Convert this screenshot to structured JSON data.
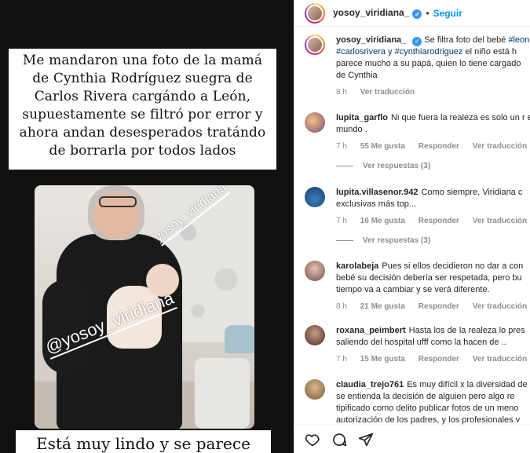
{
  "story": {
    "top_text": "Me mandaron una foto de la mamá\nde Cynthia Rodríguez suegra de\nCarlos Rivera cargándo a León,\nsupuestamente se filtró por error y\nahora andan desesperados tratándo\nde borrarla por todos lados",
    "bottom_text": "Está muy lindo y se parece",
    "watermark_small": "yosoy_viridiana",
    "watermark_large": "@yosoy_viridiana"
  },
  "header": {
    "username": "yosoy_viridiana_",
    "separator": "•",
    "follow_label": "Seguir"
  },
  "caption": {
    "username": "yosoy_viridiana_",
    "text_1": "Se filtra foto del bebé",
    "tag_1": "#leon",
    "tag_2": "#carlosrivera",
    "text_2": "y",
    "tag_3": "#cynthiarodriguez",
    "text_3": "el niño está h",
    "line_2": "parece mucho a su papá, quien lo tiene cargado",
    "line_3": "de Cynthia",
    "time": "8 h",
    "translate": "Ver traducción"
  },
  "comments": [
    {
      "username": "lupita_garflo",
      "text": "Ni que fuera la realeza es solo un r el mundo .",
      "time": "7 h",
      "likes": "55 Me gusta",
      "reply": "Responder",
      "translate": "Ver traducción",
      "replies": "Ver respuestas (3)"
    },
    {
      "username": "lupita.villasenor.942",
      "text": "Como siempre, Viridiana c exclusivas más top...",
      "time": "7 h",
      "likes": "16 Me gusta",
      "reply": "Responder",
      "translate": "Ver traducción",
      "replies": "Ver respuestas (3)"
    },
    {
      "username": "karolabeja",
      "text": "Pues si ellos decidieron no dar a con bebé su decisión debería ser respetada, pero bu tiempo va a cambiar y se verá diferente.",
      "time": "8 h",
      "likes": "21 Me gusta",
      "reply": "Responder",
      "translate": "Ver traducción"
    },
    {
      "username": "roxana_peimbert",
      "text": "Hasta los de la realeza lo pres saliendo del hospital ufff como la hacen de ..",
      "time": "7 h",
      "likes": "15 Me gusta",
      "reply": "Responder",
      "translate": "Ver traducción"
    },
    {
      "username": "claudia_trejo761",
      "text": "Es muy difícil x la diversidad de q se entienda la decisión de alguien pero algo re tipificado como delito publicar fotos de un meno autorización de los padres, y los profesionales v"
    }
  ],
  "icons": {
    "like": "heart-icon",
    "comment": "comment-icon",
    "share": "share-icon"
  },
  "colors": {
    "link": "#0095f6",
    "verified": "#3897f0",
    "muted": "#8e8e8e",
    "text": "#262626"
  }
}
